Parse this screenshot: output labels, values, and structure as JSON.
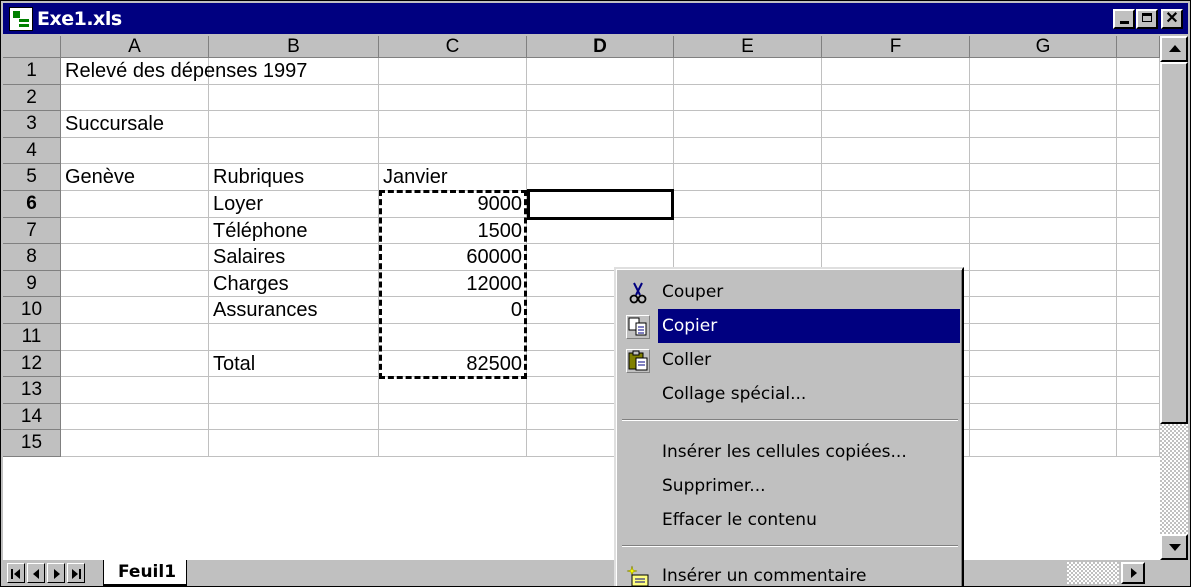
{
  "window": {
    "title": "Exe1.xls"
  },
  "columns": [
    "A",
    "B",
    "C",
    "D",
    "E",
    "F",
    "G"
  ],
  "rows": [
    {
      "n": "1",
      "a": "Relevé des dépenses 1997",
      "b": "",
      "c": ""
    },
    {
      "n": "2",
      "a": "",
      "b": "",
      "c": ""
    },
    {
      "n": "3",
      "a": "Succursale",
      "b": "",
      "c": ""
    },
    {
      "n": "4",
      "a": "",
      "b": "",
      "c": ""
    },
    {
      "n": "5",
      "a": "Genève",
      "b": "Rubriques",
      "c": "Janvier"
    },
    {
      "n": "6",
      "a": "",
      "b": "Loyer",
      "c": "9000"
    },
    {
      "n": "7",
      "a": "",
      "b": "Téléphone",
      "c": "1500"
    },
    {
      "n": "8",
      "a": "",
      "b": "Salaires",
      "c": "60000"
    },
    {
      "n": "9",
      "a": "",
      "b": "Charges",
      "c": "12000"
    },
    {
      "n": "10",
      "a": "",
      "b": "Assurances",
      "c": "0"
    },
    {
      "n": "11",
      "a": "",
      "b": "",
      "c": ""
    },
    {
      "n": "12",
      "a": "",
      "b": "Total",
      "c": "82500"
    },
    {
      "n": "13",
      "a": "",
      "b": "",
      "c": ""
    },
    {
      "n": "14",
      "a": "",
      "b": "",
      "c": ""
    },
    {
      "n": "15",
      "a": "",
      "b": "",
      "c": ""
    }
  ],
  "active_cell": {
    "column": "D",
    "row": "6"
  },
  "sheet_tab": "Feuil1",
  "context_menu": {
    "items": [
      {
        "label": "Couper",
        "icon": "scissors-icon",
        "highlighted": false
      },
      {
        "label": "Copier",
        "icon": "copy-icon",
        "highlighted": true
      },
      {
        "label": "Coller",
        "icon": "paste-icon",
        "highlighted": false
      },
      {
        "label": "Collage spécial...",
        "icon": "",
        "highlighted": false
      },
      {
        "label": "Insérer les cellules copiées...",
        "icon": "",
        "highlighted": false
      },
      {
        "label": "Supprimer...",
        "icon": "",
        "highlighted": false
      },
      {
        "label": "Effacer le contenu",
        "icon": "",
        "highlighted": false
      },
      {
        "label": "Insérer un commentaire",
        "icon": "comment-icon",
        "highlighted": false
      }
    ]
  },
  "colors": {
    "titlebar": "#000080",
    "highlight": "#000080",
    "chrome": "#c0c0c0"
  }
}
